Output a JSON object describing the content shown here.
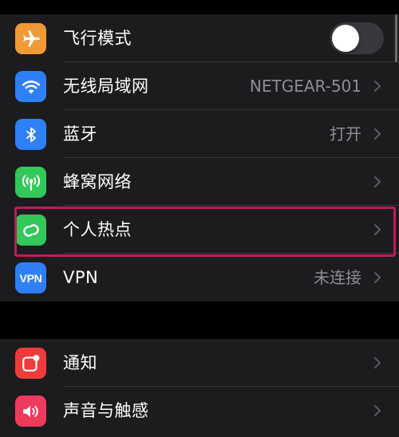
{
  "groups": {
    "connectivity": {
      "rows": [
        {
          "label": "飞行模式",
          "icon": "airplane-icon",
          "icon_color": "#f09a37",
          "toggle_on": false
        },
        {
          "label": "无线局域网",
          "icon": "wifi-icon",
          "icon_color": "#2f7ff6",
          "value": "NETGEAR-501"
        },
        {
          "label": "蓝牙",
          "icon": "bluetooth-icon",
          "icon_color": "#2f7ff6",
          "value": "打开"
        },
        {
          "label": "蜂窝网络",
          "icon": "cellular-icon",
          "icon_color": "#34c759"
        },
        {
          "label": "个人热点",
          "icon": "hotspot-icon",
          "icon_color": "#34c759"
        },
        {
          "label": "VPN",
          "icon": "vpn-icon",
          "icon_color": "#2f7ff6",
          "icon_text": "VPN",
          "value": "未连接"
        }
      ]
    },
    "notifications": {
      "rows": [
        {
          "label": "通知",
          "icon": "notifications-icon",
          "icon_color": "#ee3b3b"
        },
        {
          "label": "声音与触感",
          "icon": "sound-icon",
          "icon_color": "#ee3b5c"
        }
      ]
    }
  },
  "highlight_color": "#c2185b"
}
